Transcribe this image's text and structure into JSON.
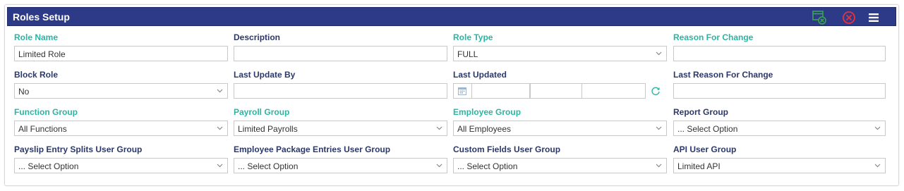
{
  "header": {
    "title": "Roles Setup",
    "icons": [
      "save-new-icon",
      "close-circle-icon",
      "hamburger-menu-icon"
    ]
  },
  "colors": {
    "header_bg": "#2d3a88",
    "label_accent": "#2bb5a2",
    "label_default": "#2c3869",
    "save_icon": "#3aa64c",
    "close_icon": "#e8323c"
  },
  "fields": {
    "role_name": {
      "label": "Role Name",
      "value": "Limited Role"
    },
    "description": {
      "label": "Description",
      "value": ""
    },
    "role_type": {
      "label": "Role Type",
      "value": "FULL"
    },
    "reason_for_change": {
      "label": "Reason For Change",
      "value": ""
    },
    "block_role": {
      "label": "Block Role",
      "value": "No"
    },
    "last_update_by": {
      "label": "Last Update By",
      "value": ""
    },
    "last_updated": {
      "label": "Last Updated",
      "value": ""
    },
    "last_reason_for_change": {
      "label": "Last Reason For Change",
      "value": ""
    },
    "function_group": {
      "label": "Function Group",
      "value": "All Functions"
    },
    "payroll_group": {
      "label": "Payroll Group",
      "value": "Limited Payrolls"
    },
    "employee_group": {
      "label": "Employee Group",
      "value": "All Employees"
    },
    "report_group": {
      "label": "Report Group",
      "value": "... Select Option"
    },
    "payslip_entry_splits_user_group": {
      "label": "Payslip Entry Splits User Group",
      "value": "... Select Option"
    },
    "employee_package_entries_user_group": {
      "label": "Employee Package Entries User Group",
      "value": "... Select Option"
    },
    "custom_fields_user_group": {
      "label": "Custom Fields User Group",
      "value": "... Select Option"
    },
    "api_user_group": {
      "label": "API User Group",
      "value": "Limited API"
    }
  }
}
